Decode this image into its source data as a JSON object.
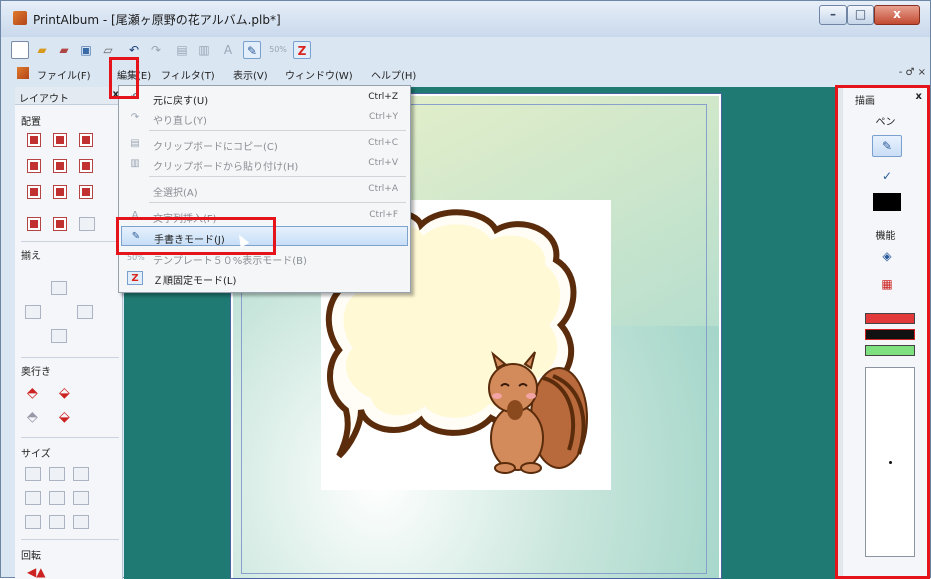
{
  "window": {
    "title": "PrintAlbum - [尾瀬ヶ原野の花アルバム.plb*]",
    "min": "–",
    "max": "□",
    "close": "x"
  },
  "toolbar": {
    "icons": [
      "new-icon",
      "open-icon",
      "save-icon",
      "print-preview-icon",
      "print-icon",
      "undo-icon",
      "redo-icon",
      "copy-icon",
      "paste-icon",
      "text-icon",
      "pen-icon",
      "zoom50-icon",
      "z-order-icon"
    ],
    "label_50": "50%",
    "label_z": "Z"
  },
  "menubar": {
    "items": [
      "ファイル(F)",
      "編集(E)",
      "フィルタ(T)",
      "表示(V)",
      "ウィンドウ(W)",
      "ヘルプ(H)"
    ],
    "mdi": "- ♂ ×"
  },
  "left_panel": {
    "title": "レイアウト",
    "close": "x",
    "sections": [
      "配置",
      "揃え",
      "奥行き",
      "サイズ",
      "回転"
    ]
  },
  "edit_menu": {
    "items": [
      {
        "label": "元に戻す(U)",
        "shortcut": "Ctrl+Z",
        "icon": "↶",
        "disabled": false
      },
      {
        "label": "やり直し(Y)",
        "shortcut": "Ctrl+Y",
        "icon": "↷",
        "disabled": true
      },
      {
        "label": "クリップボードにコピー(C)",
        "shortcut": "Ctrl+C",
        "icon": "▤",
        "disabled": true
      },
      {
        "label": "クリップボードから貼り付け(H)",
        "shortcut": "Ctrl+V",
        "icon": "▥",
        "disabled": true
      },
      {
        "label": "全選択(A)",
        "shortcut": "Ctrl+A",
        "icon": "",
        "disabled": true
      },
      {
        "label": "文字列挿入(F)",
        "shortcut": "Ctrl+F",
        "icon": "A",
        "disabled": true
      },
      {
        "label": "手書きモード(J)",
        "shortcut": "",
        "icon": "✎",
        "disabled": false
      },
      {
        "label": "テンプレート５０%表示モード(B)",
        "shortcut": "",
        "icon": "50%",
        "disabled": true
      },
      {
        "label": "Ｚ順固定モード(L)",
        "shortcut": "",
        "icon": "Z",
        "disabled": false
      }
    ]
  },
  "right_panel": {
    "title": "描画",
    "close": "x",
    "pen_section": "ペン",
    "func_section": "機能",
    "colors": {
      "red": "#e23a3a",
      "black": "#111111",
      "green": "#7fe07f"
    }
  }
}
